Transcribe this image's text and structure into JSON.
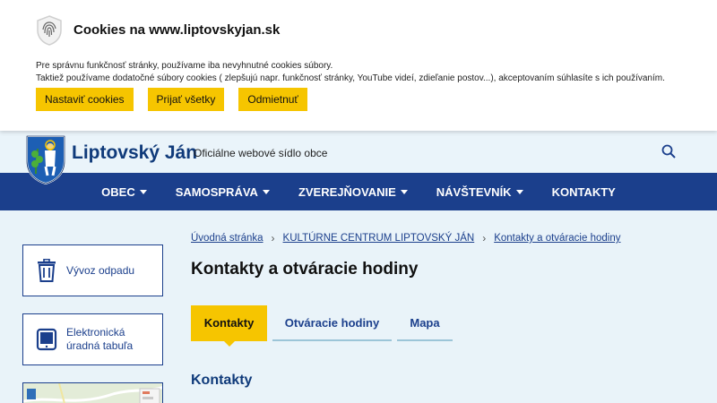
{
  "cookie": {
    "title": "Cookies na www.liptovskyjan.sk",
    "line1": "Pre správnu funkčnosť stránky, používame iba nevyhnutné cookies súbory.",
    "line2": "Taktiež používame dodatočné súbory cookies ( zlepšujú napr. funkčnosť stránky, YouTube videí, zdieľanie postov...), akceptovaním súhlasíte s ich používaním.",
    "buttons": {
      "settings": "Nastaviť cookies",
      "accept_all": "Prijať všetky",
      "reject": "Odmietnuť"
    }
  },
  "header": {
    "site_name": "Liptovský Ján",
    "site_subtitle": "Oficiálne webové sídlo obce"
  },
  "nav": {
    "items": [
      {
        "label": "OBEC",
        "has_dropdown": true
      },
      {
        "label": "SAMOSPRÁVA",
        "has_dropdown": true
      },
      {
        "label": "ZVEREJŇOVANIE",
        "has_dropdown": true
      },
      {
        "label": "NÁVŠTEVNÍK",
        "has_dropdown": true
      },
      {
        "label": "KONTAKTY",
        "has_dropdown": false
      }
    ]
  },
  "sidebar": {
    "cards": [
      {
        "label": "Vývoz odpadu",
        "icon": "trash-icon"
      },
      {
        "label_line1": "Elektronická",
        "label_line2": "úradná tabuľa",
        "icon": "tablet-icon"
      }
    ]
  },
  "breadcrumb": {
    "items": [
      "Úvodná stránka",
      "KULTÚRNE CENTRUM LIPTOVSKÝ JÁN",
      "Kontakty a otváracie hodiny"
    ]
  },
  "main": {
    "title": "Kontakty a otváracie hodiny",
    "tabs": [
      "Kontakty",
      "Otváracie hodiny",
      "Mapa"
    ],
    "active_tab": "Kontakty",
    "section_title": "Kontakty"
  },
  "colors": {
    "accent": "#f6c500",
    "brand_blue": "#1b3f8c",
    "page_bg": "#e9f3f9"
  }
}
